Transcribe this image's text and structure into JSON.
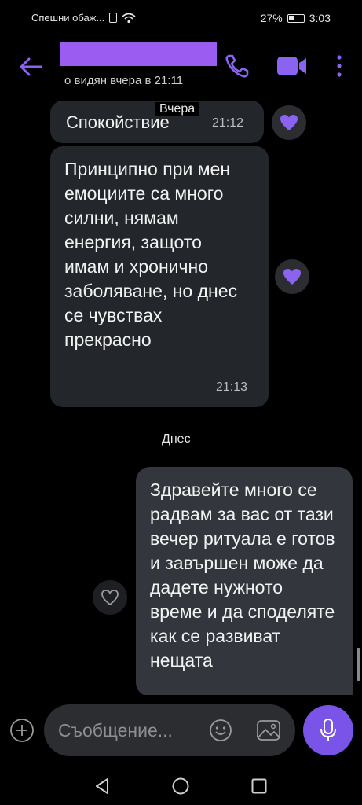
{
  "status_bar": {
    "carrier_text": "Спешни обаж...",
    "battery": "27%",
    "time": "3:03"
  },
  "header": {
    "last_seen": "о видян вчера в 21:11",
    "accent_color": "#8a63f0"
  },
  "conversation": {
    "date_yesterday": "Вчера",
    "date_today": "Днес",
    "messages": [
      {
        "text": "Спокойствие",
        "time": "21:12",
        "direction": "in",
        "liked": true
      },
      {
        "text": "Принципно при мен емоциите са много силни, нямам енергия, защото имам и хронично заболяване, но днес се чувствах прекрасно",
        "time": "21:13",
        "direction": "in",
        "liked": true
      },
      {
        "text": "Здравейте много се радвам за вас от тази вечер ритуала е готов и завършен може да дадете нужното време и да споделяте как се развиват нещата",
        "time": "",
        "direction": "out",
        "liked": false
      }
    ]
  },
  "composer": {
    "placeholder": "Съобщение..."
  }
}
